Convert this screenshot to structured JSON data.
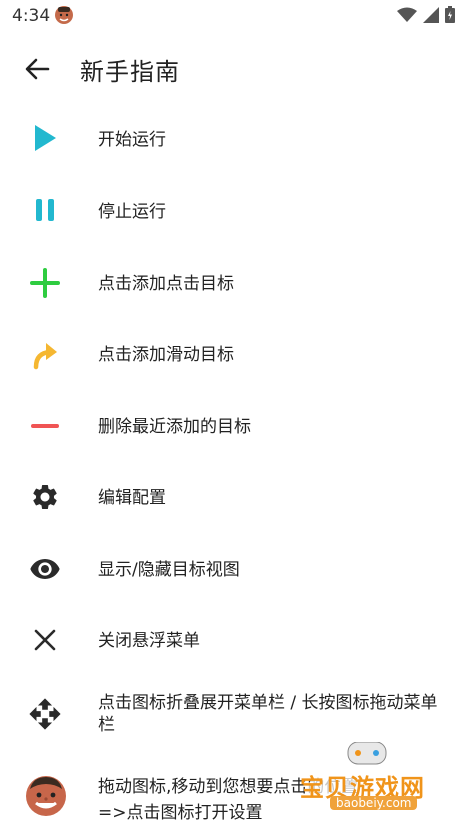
{
  "status": {
    "time": "4:34"
  },
  "toolbar": {
    "title": "新手指南"
  },
  "items": [
    {
      "icon": "play-icon",
      "label": "开始运行"
    },
    {
      "icon": "pause-icon",
      "label": "停止运行"
    },
    {
      "icon": "plus-icon",
      "label": "点击添加点击目标"
    },
    {
      "icon": "swipe-arrow-icon",
      "label": "点击添加滑动目标"
    },
    {
      "icon": "minus-icon",
      "label": "删除最近添加的目标"
    },
    {
      "icon": "gear-icon",
      "label": "编辑配置"
    },
    {
      "icon": "eye-icon",
      "label": "显示/隐藏目标视图"
    },
    {
      "icon": "close-icon",
      "label": "关闭悬浮菜单"
    },
    {
      "icon": "move-icon",
      "label": "点击图标折叠展开菜单栏 / 长按图标拖动菜单栏"
    },
    {
      "icon": "avatar-icon",
      "label": "拖动图标,移动到您想要点击的位置",
      "label2": "=>点击图标打开设置"
    }
  ],
  "watermark": {
    "text": "宝贝游戏网",
    "url": "baobeiy.com"
  },
  "colors": {
    "play": "#22b8cf",
    "plus": "#2ecc40",
    "swipe": "#f5b731",
    "minus": "#f05454"
  }
}
